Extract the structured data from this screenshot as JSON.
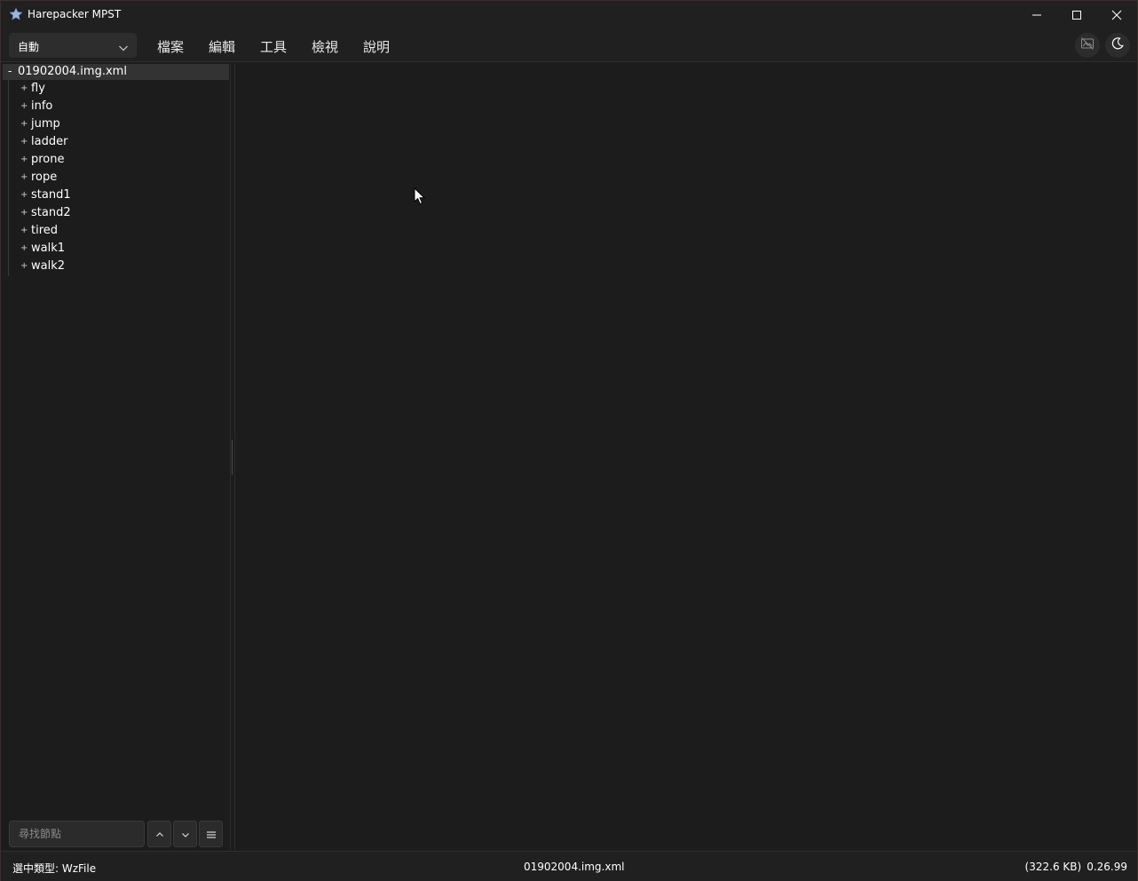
{
  "window": {
    "title": "Harepacker MPST"
  },
  "toolbar": {
    "mode_select_value": "自動"
  },
  "menu": {
    "items": [
      "檔案",
      "編輯",
      "工具",
      "檢視",
      "說明"
    ]
  },
  "tree": {
    "root": {
      "toggle": "-",
      "label": "01902004.img.xml"
    },
    "children": [
      {
        "toggle": "+",
        "label": "fly"
      },
      {
        "toggle": "+",
        "label": "info"
      },
      {
        "toggle": "+",
        "label": "jump"
      },
      {
        "toggle": "+",
        "label": "ladder"
      },
      {
        "toggle": "+",
        "label": "prone"
      },
      {
        "toggle": "+",
        "label": "rope"
      },
      {
        "toggle": "+",
        "label": "stand1"
      },
      {
        "toggle": "+",
        "label": "stand2"
      },
      {
        "toggle": "+",
        "label": "tired"
      },
      {
        "toggle": "+",
        "label": "walk1"
      },
      {
        "toggle": "+",
        "label": "walk2"
      }
    ]
  },
  "search": {
    "placeholder": "尋找節點"
  },
  "status": {
    "selected_type": "選中類型: WzFile",
    "file_name": "01902004.img.xml",
    "file_size": "(322.6 KB)",
    "version": "0.26.99"
  },
  "icons": {
    "app": "star-icon",
    "minimize": "minimize-icon",
    "maximize": "maximize-icon",
    "close": "close-icon",
    "dropdown": "chevron-down-icon",
    "animation_toggle": "image-off-icon",
    "theme_toggle": "moon-icon",
    "search_up": "chevron-up-icon",
    "search_down": "chevron-down-icon",
    "search_options": "menu-icon"
  },
  "colors": {
    "background": "#1c1c1c",
    "chrome": "#202020",
    "selection": "#333333",
    "text": "#ffffff"
  }
}
